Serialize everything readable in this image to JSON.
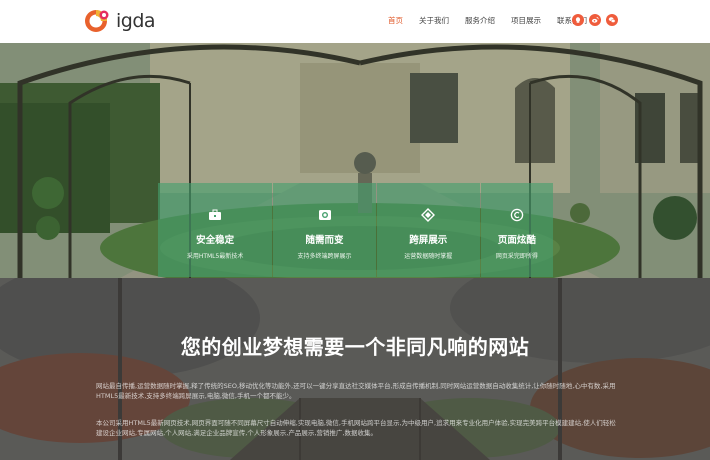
{
  "brand": {
    "name": "igda"
  },
  "nav": [
    {
      "label": "首页"
    },
    {
      "label": "关于我们"
    },
    {
      "label": "服务介绍"
    },
    {
      "label": "项目展示"
    },
    {
      "label": "联系我们"
    }
  ],
  "social_icons": [
    "qq-icon",
    "weibo-icon",
    "wechat-icon"
  ],
  "features": [
    {
      "icon": "briefcase-icon",
      "title": "安全稳定",
      "desc": "采用HTML5最新技术"
    },
    {
      "icon": "camera-icon",
      "title": "随需而变",
      "desc": "支持多终端跨屏展示"
    },
    {
      "icon": "layers-icon",
      "title": "跨屏展示",
      "desc": "运营数据随时掌握"
    },
    {
      "icon": "copyright-icon",
      "title": "页面炫酷",
      "desc": "网页采完即所得"
    }
  ],
  "headline": "您的创业梦想需要一个非同凡响的网站",
  "paragraphs": [
    "网站最自传播,运营数据随时掌握,释了传统的SEO,移动优化等功能外,还可以一键分享直达社交媒体平台,形成自传播机制,同时网站运营数据自动收集统计,让你随时随地,心中有数,采用HTML5最新技术,支持多终端跨屏展示,电脑,微信,手机一个都不能少。",
    "本公司采用HTML5最新网页技术,网页界面可随不同屏幕尺寸自动伸缩,实现电脑,微信,手机网站跨平台显示,为中级用户,追求用来专业化用户体验,实现完美跨平台模建建站,使人们轻松建设企业网站,专属网站,个人网站,满足企业品牌宣传,个人形象展示,产品展示,营销推广,数据收集。"
  ],
  "colors": {
    "accent": "#e05a2a",
    "feature_bg": "#46a06e",
    "social": "#ef5c3c"
  }
}
